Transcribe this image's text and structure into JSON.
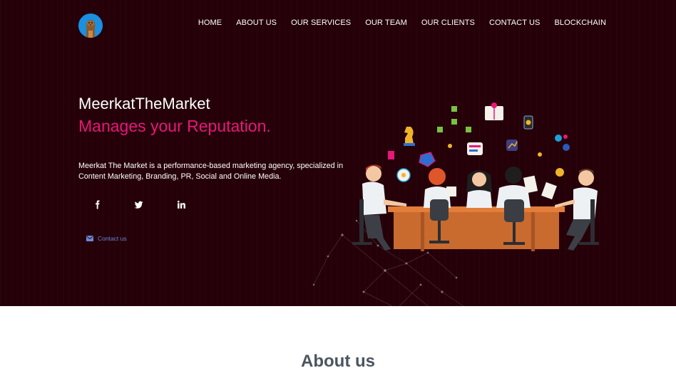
{
  "nav": {
    "items": [
      "HOME",
      "ABOUT US",
      "OUR SERVICES",
      "OUR TEAM",
      "OUR CLIENTS",
      "CONTACT US",
      "BLOCKCHAIN"
    ]
  },
  "logo": {
    "icon": "meerkat-logo-icon"
  },
  "hero": {
    "brand": "MeerkatTheMarket",
    "tagline": "Manages your Reputation.",
    "description": "Meerkat The Market is a performance-based marketing agency, specialized in Content Marketing, Branding, PR, Social and Online Media.",
    "contact_label": "Contact us",
    "social": [
      "facebook-icon",
      "twitter-icon",
      "linkedin-icon"
    ]
  },
  "about": {
    "title": "About us"
  },
  "colors": {
    "hero_bg": "#250009",
    "accent": "#e9177a",
    "link": "#6e86d8",
    "logo_bg": "#1b8fe0"
  }
}
